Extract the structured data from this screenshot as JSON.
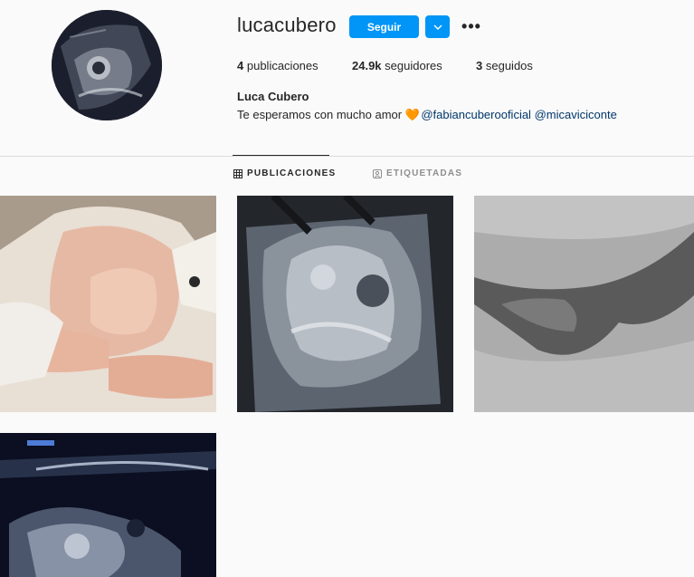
{
  "profile": {
    "username": "lucacubero",
    "follow_label": "Seguir",
    "more_label": "•••",
    "stats": {
      "posts_count": "4",
      "posts_label": "publicaciones",
      "followers_count": "24.9k",
      "followers_label": "seguidores",
      "following_count": "3",
      "following_label": "seguidos"
    },
    "full_name": "Luca Cubero",
    "bio_text": "Te esperamos con mucho amor",
    "bio_emoji": "🧡",
    "mentions": [
      "@fabiancuberooficial",
      "@micaviciconte"
    ]
  },
  "tabs": [
    {
      "label": "PUBLICACIONES",
      "icon": "grid-icon",
      "active": true
    },
    {
      "label": "ETIQUETADAS",
      "icon": "tag-person-icon",
      "active": false
    }
  ],
  "posts": [
    {
      "subject": "hands-on-belly-photo"
    },
    {
      "subject": "ultrasound-printout-photo"
    },
    {
      "subject": "ultrasound-scan"
    },
    {
      "subject": "ultrasound-screen-photo"
    }
  ],
  "colors": {
    "accent": "#0095f6",
    "mention": "#00376b",
    "muted": "#8e8e8e",
    "border": "#dbdbdb",
    "background": "#fafafa"
  }
}
